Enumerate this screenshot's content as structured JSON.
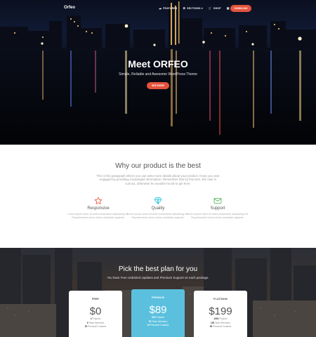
{
  "nav": {
    "brand": "Orfeo",
    "menu": [
      {
        "icon": "cloud-icon",
        "label": "FEATURES"
      },
      {
        "icon": "gear-icon",
        "label": "SECTIONS ▾"
      },
      {
        "icon": "cart-icon",
        "label": "SHOP"
      },
      {
        "icon": "document-icon",
        "label": "BLOG"
      }
    ],
    "cta": "DOWNLOAD"
  },
  "hero": {
    "title": "Meet ORFEO",
    "subtitle": "Simple, Reliable and Awesome WordPress Theme",
    "button": "SEE MORE"
  },
  "features": {
    "title": "Why our product is the best",
    "text": "This is the paragraph where you can write more details about your product. Keep you user engaged by providing meaningful information. Remember that by this time, the user is curious, otherwise he wouldn't scroll to get here.",
    "items": [
      {
        "icon": "star-icon",
        "color": "#e5533d",
        "title": "Responsive",
        "text": "Lorem ipsum dolor sit amet consectetur adipisicing elit. Reprehenderit nemo minus molestiae sapiente."
      },
      {
        "icon": "diamond-icon",
        "color": "#26c6da",
        "title": "Quality",
        "text": "Lorem ipsum dolor sit amet consectetur adipisicing elit. Reprehenderit nemo minus molestiae sapiente."
      },
      {
        "icon": "mail-icon",
        "color": "#4caf50",
        "title": "Support",
        "text": "Lorem ipsum dolor sit amet consectetur adipisicing elit. Reprehenderit nemo minus molestiae sapiente."
      }
    ]
  },
  "pricing": {
    "title": "Pick the best plan for you",
    "subtitle": "You have Free Unlimited Updates and Premium Support on each package.",
    "plans": [
      {
        "name": "FREE",
        "price": "$0",
        "lines": [
          [
            "3",
            " Projects"
          ],
          [
            "5",
            " Team Members"
          ],
          [
            "20",
            " Personal Contacts"
          ]
        ]
      },
      {
        "name": "PREMIUM",
        "price": "$89",
        "lines": [
          [
            "500",
            " Projects"
          ],
          [
            "50",
            " Team Members"
          ],
          [
            "10",
            " Personal Contacts"
          ]
        ]
      },
      {
        "name": "PLATINUM",
        "price": "$199",
        "lines": [
          [
            "1000",
            " Projects"
          ],
          [
            "100",
            " Team Members"
          ],
          [
            "50",
            " Personal Contacts"
          ]
        ]
      }
    ]
  },
  "colors": {
    "accent": "#e5533d",
    "featured": "#5bc0de"
  }
}
